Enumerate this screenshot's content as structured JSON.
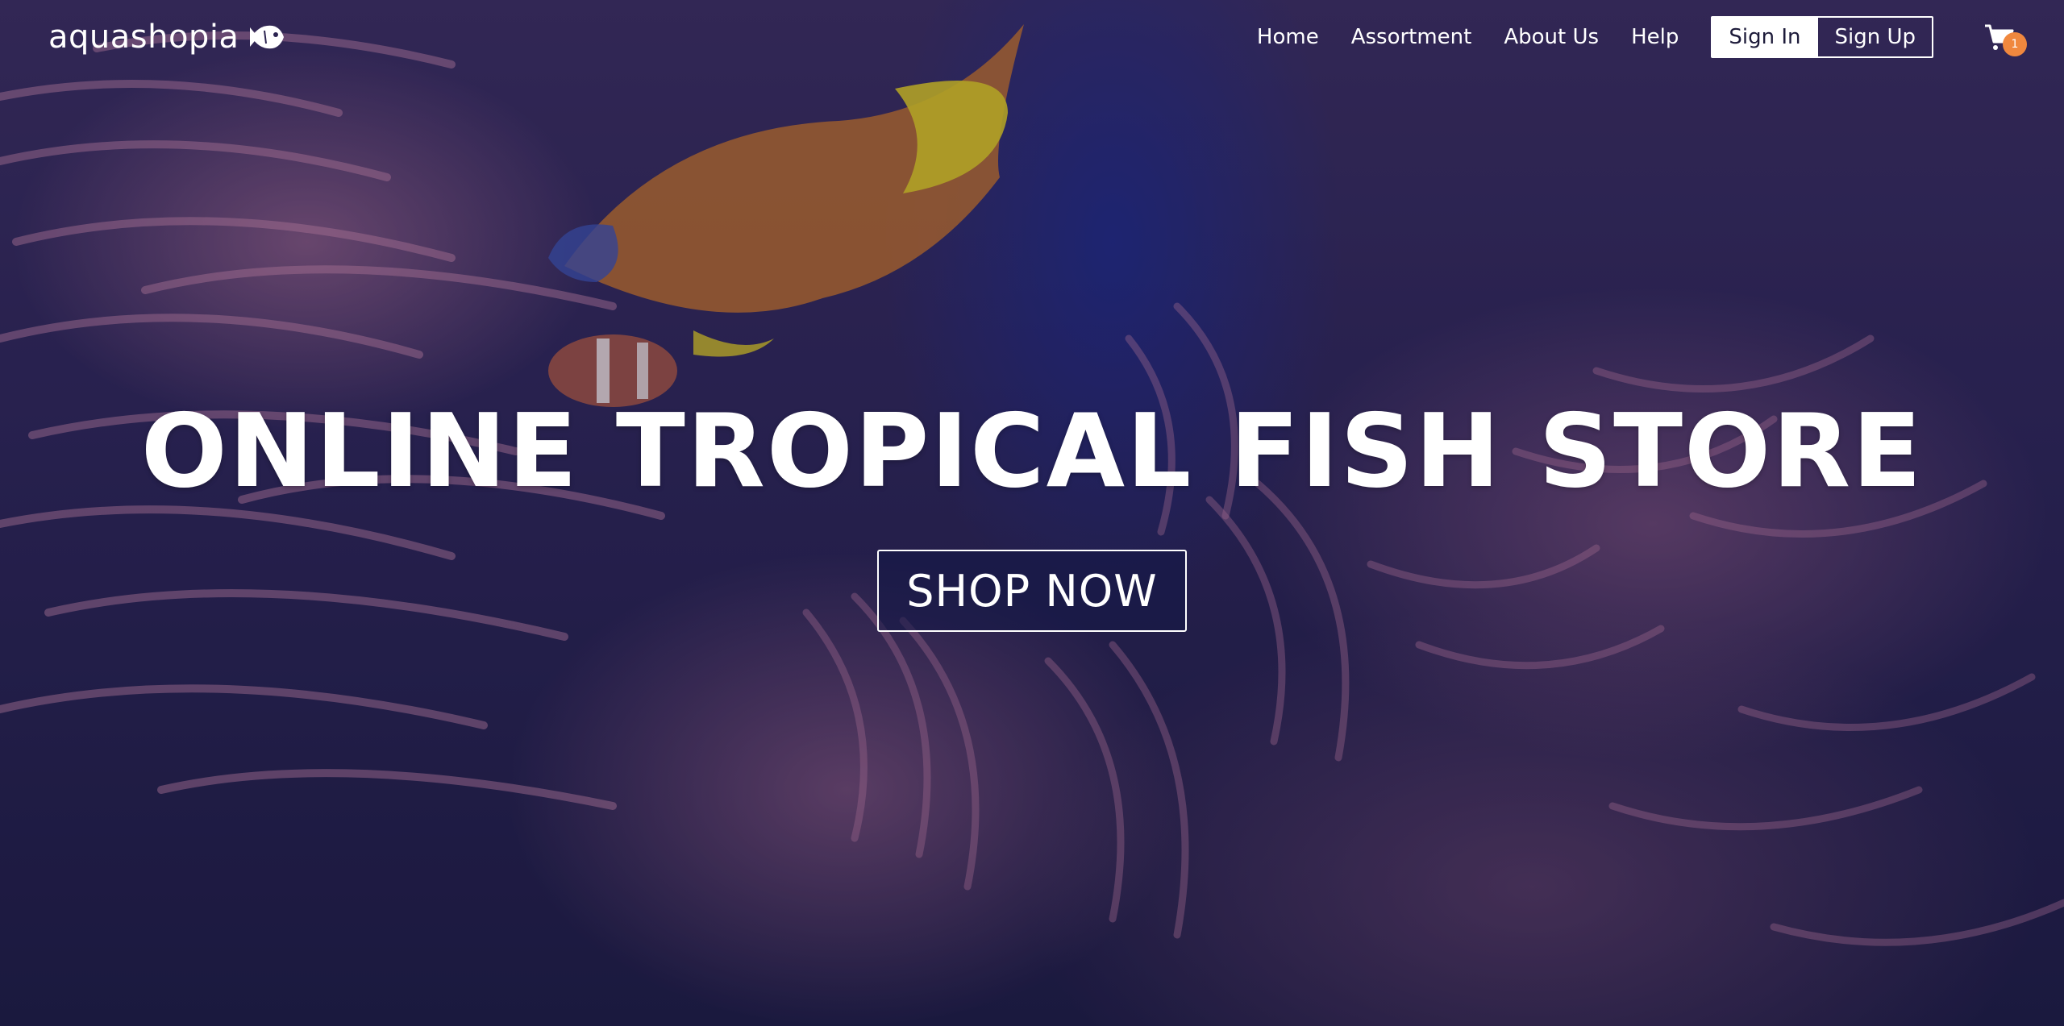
{
  "brand": {
    "name": "aquashopia",
    "icon": "fish-icon"
  },
  "nav": {
    "links": [
      "Home",
      "Assortment",
      "About Us",
      "Help"
    ],
    "sign_in": "Sign In",
    "sign_up": "Sign Up",
    "cart_icon": "shopping-cart-icon",
    "cart_count": "1"
  },
  "hero": {
    "title": "ONLINE TROPICAL FISH STORE",
    "cta": "SHOP NOW"
  },
  "colors": {
    "overlay": "#19164a",
    "badge": "#f0883e",
    "text": "#ffffff"
  }
}
